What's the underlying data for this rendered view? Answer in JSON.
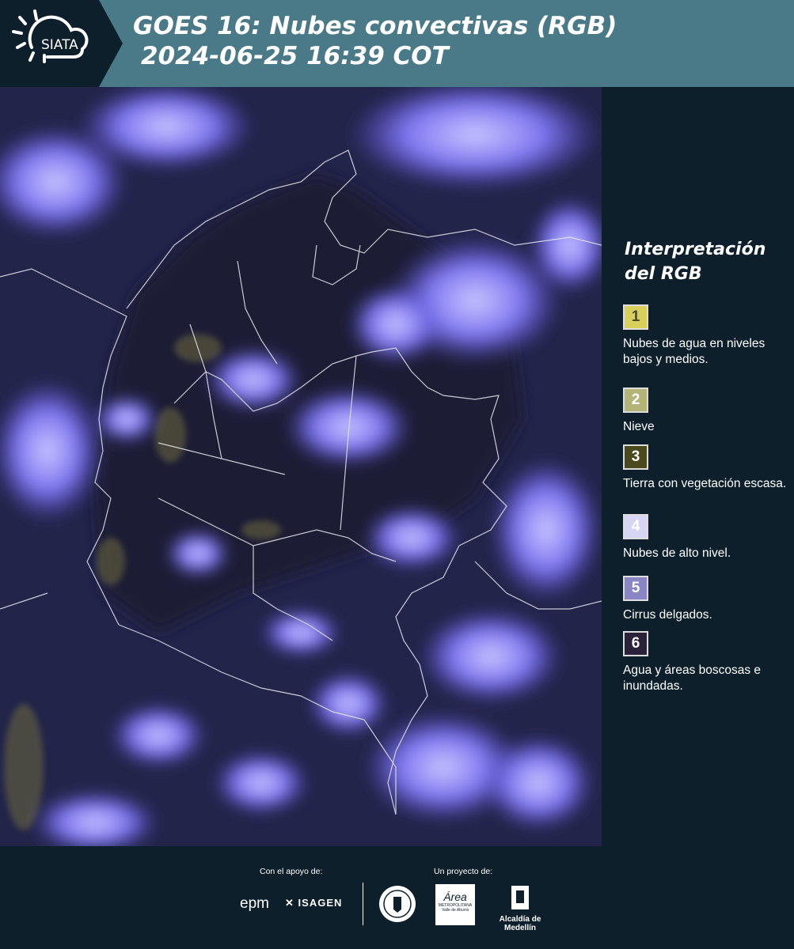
{
  "header": {
    "logo_text": "SIATA",
    "title_line1": "GOES 16: Nubes convectivas (RGB)",
    "title_line2": "2024-06-25 16:39 COT"
  },
  "legend": {
    "title_line1": "Interpretación",
    "title_line2": "del RGB",
    "items": [
      {
        "num": "1",
        "color": "#d8d05a",
        "numcolor": "#4a4a2a",
        "label": "Nubes de agua en niveles bajos y medios."
      },
      {
        "num": "2",
        "color": "#b5b478",
        "numcolor": "#ffffff",
        "label": "Nieve"
      },
      {
        "num": "3",
        "color": "#4a4a1e",
        "numcolor": "#ffffff",
        "label": "Tierra con vegetación escasa."
      },
      {
        "num": "4",
        "color": "#d6d5f4",
        "numcolor": "#ffffff",
        "label": "Nubes de alto nivel."
      },
      {
        "num": "5",
        "color": "#8a86c6",
        "numcolor": "#ffffff",
        "label": "Cirrus delgados."
      },
      {
        "num": "6",
        "color": "#2a2238",
        "numcolor": "#ffffff",
        "label": "Agua y áreas boscosas e inundadas."
      }
    ]
  },
  "footer": {
    "support_label": "Con el apoyo de:",
    "project_label": "Un proyecto de:",
    "epm": "epm",
    "isagen": "ISAGEN",
    "area_name": "Área",
    "area_sub1": "METROPOLITANA",
    "area_sub2": "Valle de Aburrá",
    "alcaldia": "Alcaldía de Medellín"
  },
  "colors": {
    "header_bg": "#4a7a87",
    "page_bg": "#0c1f2b",
    "cloud": "#7a74ee"
  }
}
